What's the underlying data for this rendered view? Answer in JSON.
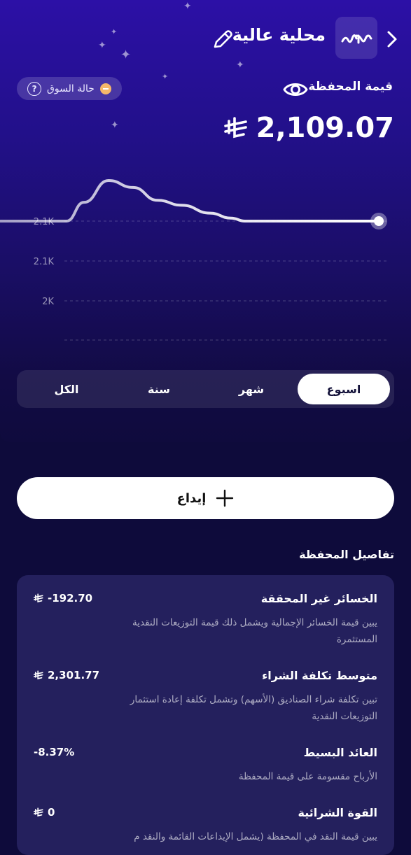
{
  "header": {
    "title": "محلية عالية",
    "back_icon": "chevron-right-icon",
    "edit_icon": "pencil-icon",
    "logo_icon": "wave-logo-icon"
  },
  "market_status": {
    "label": "حالة السوق",
    "status_color": "#f5b86a"
  },
  "portfolio": {
    "label": "قيمة المحفظة",
    "value": "2,109.07",
    "currency_icon": "riyal-icon",
    "visibility_icon": "eye-icon"
  },
  "chart_data": {
    "type": "line",
    "y_tick_labels": [
      "2.1K",
      "2.1K",
      "2K"
    ],
    "values": [
      2109,
      2109,
      2109,
      2128,
      2150,
      2143,
      2130,
      2125,
      2117,
      2112,
      2109,
      2109,
      2109,
      2109,
      2109
    ],
    "grid": true,
    "line_color": "#ffffff"
  },
  "periods": {
    "items": [
      {
        "label": "اسبوع",
        "active": true
      },
      {
        "label": "شهر",
        "active": false
      },
      {
        "label": "سنة",
        "active": false
      },
      {
        "label": "الكل",
        "active": false
      }
    ]
  },
  "deposit": {
    "label": "إيداع",
    "icon": "plus-icon"
  },
  "details": {
    "title": "تفاصيل المحفظة",
    "rows": [
      {
        "title": "الخسائر غير المحققة",
        "value": "-192.70",
        "desc": "يبين قيمة الخسائر الإجمالية ويشمل ذلك قيمة التوزيعات النقدية المستثمرة"
      },
      {
        "title": "متوسط تكلفة الشراء",
        "value": "2,301.77",
        "desc": "تبين تكلفة شراء الصناديق (الأسهم) وتشمل تكلفة إعادة استثمار التوزيعات النقدية"
      },
      {
        "title": "العائد البسيط",
        "value": "-8.37%",
        "desc": "الأرباح مقسومة على قيمة المحفظة"
      },
      {
        "title": "القوة الشرائية",
        "value": "0",
        "desc": "يبين قيمة النقد في المحفظة (يشمل الإيداعات القائمة والنقد م"
      }
    ]
  },
  "colors": {
    "background": "#0e0b3b",
    "hero_top": "#2c10a6",
    "card": "#24205d",
    "accent": "#f5b86a"
  }
}
